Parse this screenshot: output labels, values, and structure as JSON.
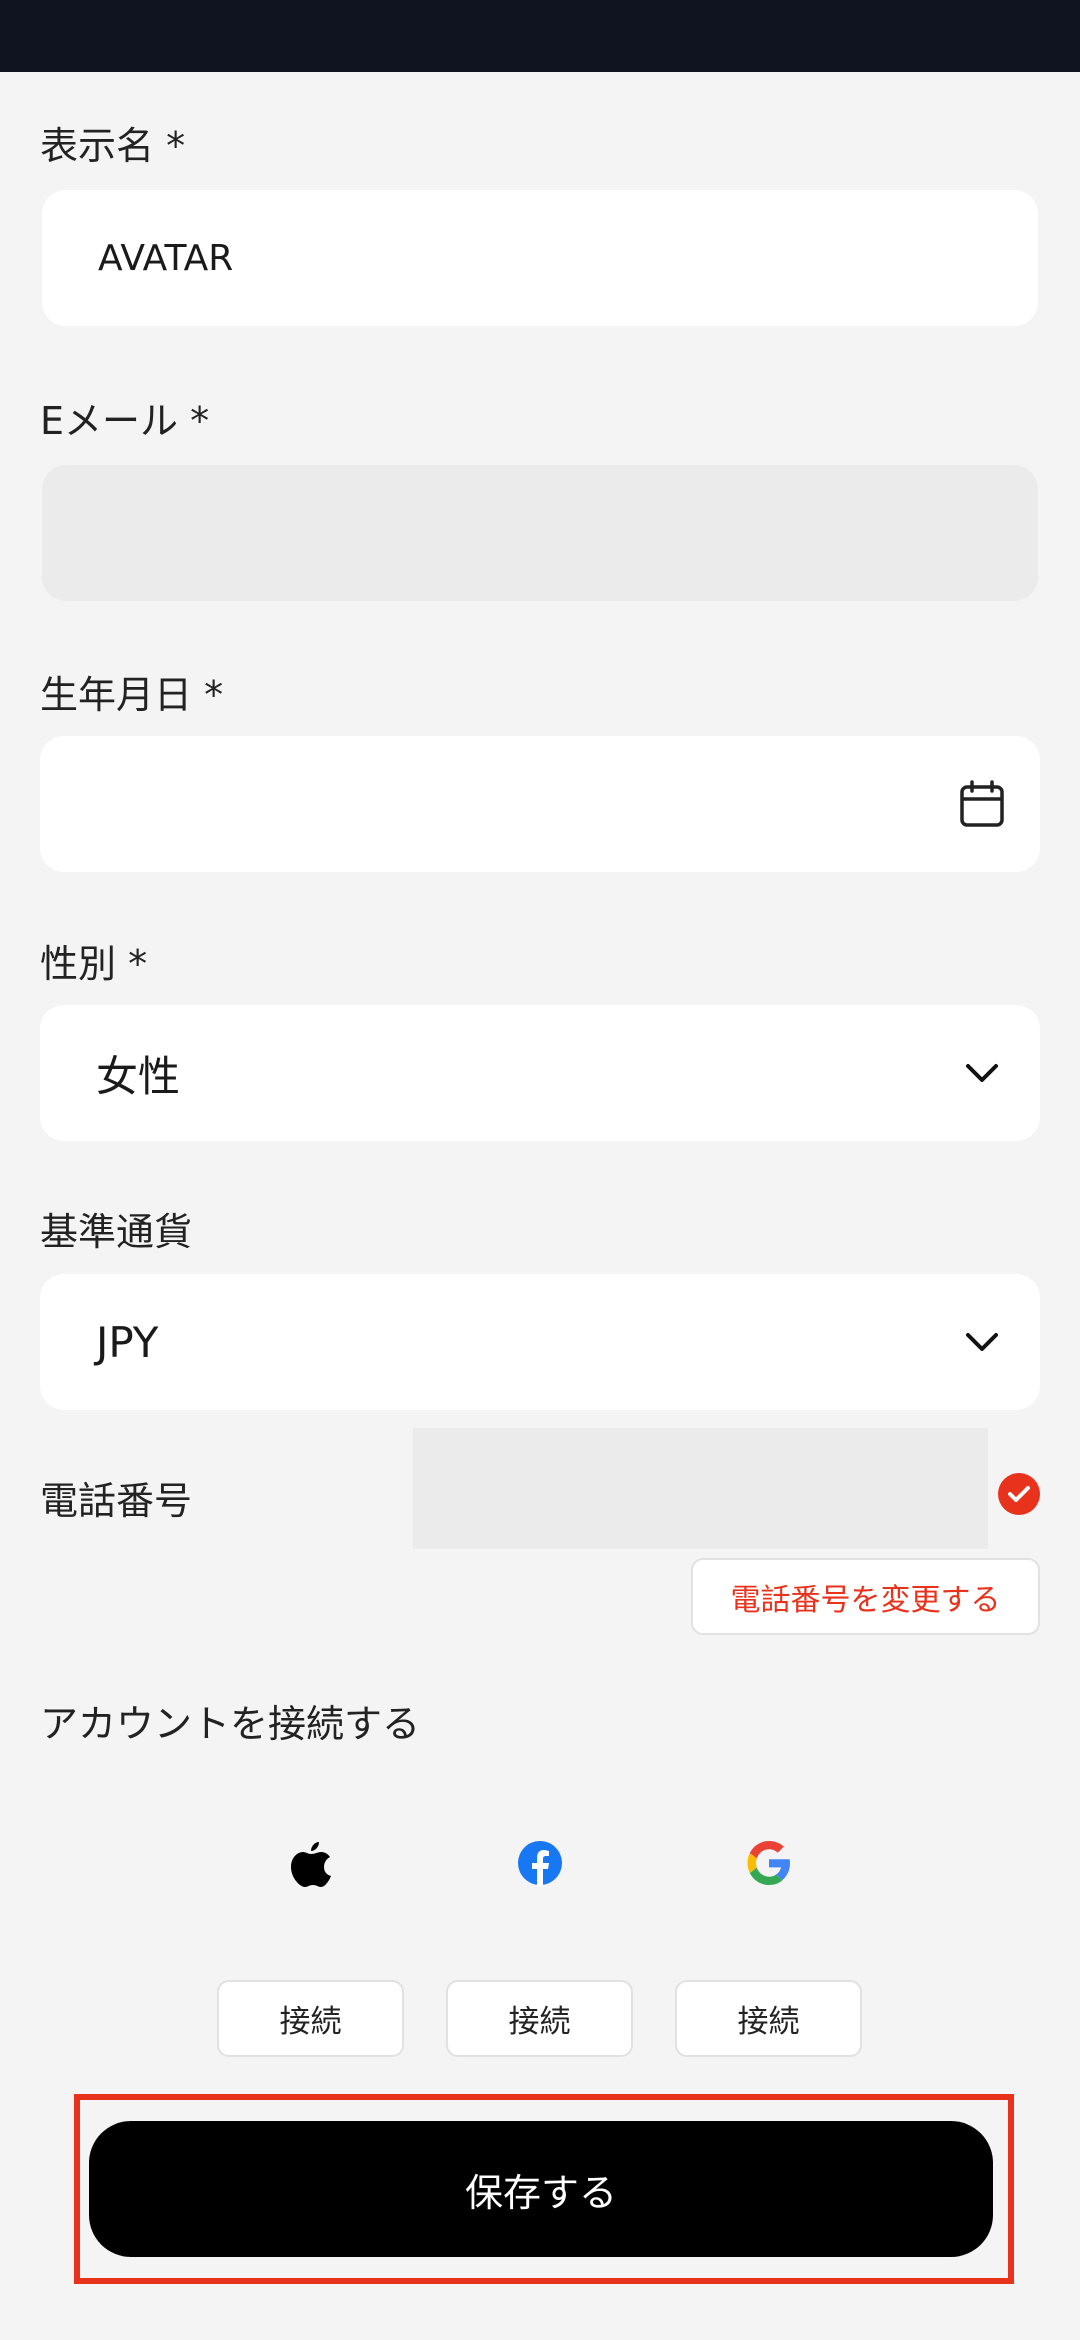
{
  "form": {
    "display_name": {
      "label": "表示名 *",
      "value": "AVATAR"
    },
    "email": {
      "label": "Eメール *",
      "value": ""
    },
    "birthdate": {
      "label": "生年月日 *",
      "value": "",
      "icon": "calendar-icon"
    },
    "gender": {
      "label": "性別 *",
      "value": "女性",
      "icon": "chevron-down-icon"
    },
    "currency": {
      "label": "基準通貨",
      "value": "JPY",
      "icon": "chevron-down-icon"
    },
    "phone": {
      "label": "電話番号",
      "value": "",
      "verified_icon": "check-circle-icon",
      "change_label": "電話番号を変更する"
    }
  },
  "connect_accounts": {
    "title": "アカウントを接続する",
    "providers": [
      {
        "icon": "apple-icon",
        "button_label": "接続"
      },
      {
        "icon": "facebook-icon",
        "button_label": "接続"
      },
      {
        "icon": "google-icon",
        "button_label": "接続"
      }
    ]
  },
  "save_button": {
    "label": "保存する"
  },
  "colors": {
    "accent_red": "#e8321c",
    "status_bar": "#0f1420",
    "background": "#f4f4f4",
    "save_button": "#000000"
  }
}
